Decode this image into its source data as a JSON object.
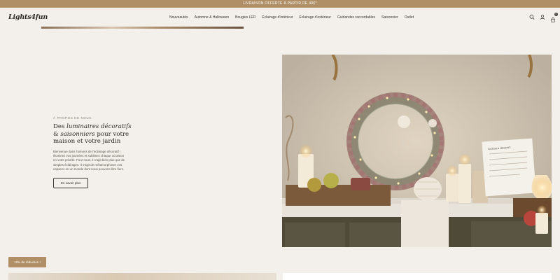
{
  "announcement": "LIVRAISON OFFERTE À PARTIR DE 40€*",
  "header": {
    "logo": "Lights4fun",
    "nav": [
      "Nouveautés",
      "Automne & Halloween",
      "Bougies LED",
      "Éclairage d'intérieur",
      "Éclairage d'extérieur",
      "Guirlandes raccordables",
      "Saisonnier",
      "Outlet"
    ],
    "icons": [
      "search-icon",
      "account-icon",
      "cart-icon"
    ],
    "cart_count": "0"
  },
  "about": {
    "eyebrow": "À PROPOS DE NOUS",
    "heading_1": "Des ",
    "heading_em_1": "luminaires décoratifs",
    "heading_2": " & ",
    "heading_em_2": "saisonniers",
    "heading_3": " pour votre maison et votre jardin",
    "body": "Bienvenue dans l'univers de l'éclairage décoratif ! Illuminez vos journées et sublimez chaque occasion en votre priorité. Pour nous, il s'agit bien plus que de simples éclairages. Il s'agit de métamorphoser vos espaces en un monde dont nous pouvons être fiers.",
    "cta": "En savoir plus"
  },
  "photo": {
    "card_title": "Autumn dessert"
  },
  "discount_button": "10% de réduction !",
  "colors": {
    "brand": "#b08f67",
    "background": "#f3f0eb",
    "text": "#2d2a26"
  }
}
